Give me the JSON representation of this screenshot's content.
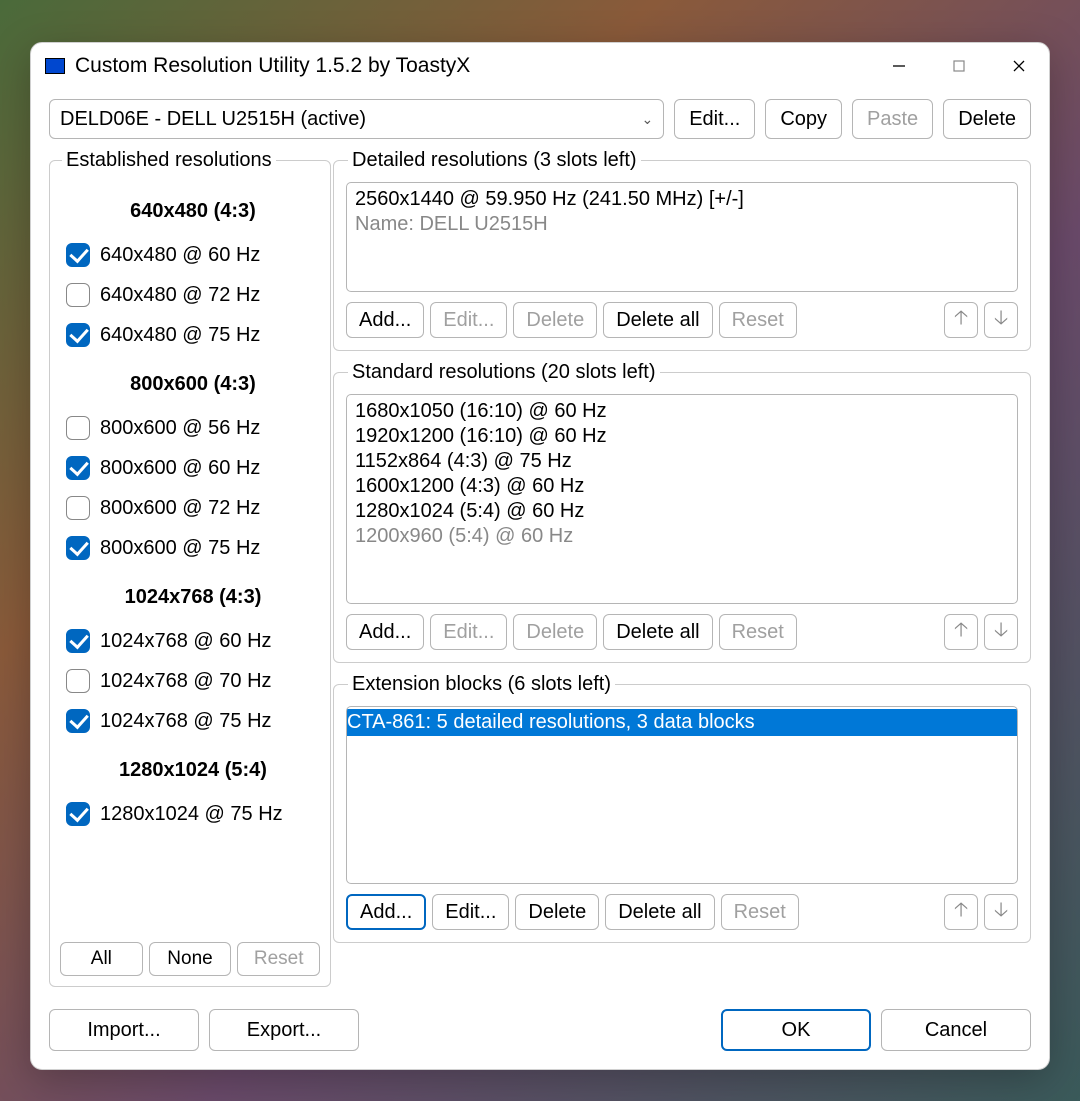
{
  "window": {
    "title": "Custom Resolution Utility 1.5.2 by ToastyX"
  },
  "topbar": {
    "display_selected": "DELD06E - DELL U2515H (active)",
    "edit_label": "Edit...",
    "copy_label": "Copy",
    "paste_label": "Paste",
    "delete_label": "Delete"
  },
  "established": {
    "legend": "Established resolutions",
    "groups": [
      {
        "header": "640x480 (4:3)",
        "items": [
          {
            "label": "640x480 @ 60 Hz",
            "checked": true
          },
          {
            "label": "640x480 @ 72 Hz",
            "checked": false
          },
          {
            "label": "640x480 @ 75 Hz",
            "checked": true
          }
        ]
      },
      {
        "header": "800x600 (4:3)",
        "items": [
          {
            "label": "800x600 @ 56 Hz",
            "checked": false
          },
          {
            "label": "800x600 @ 60 Hz",
            "checked": true
          },
          {
            "label": "800x600 @ 72 Hz",
            "checked": false
          },
          {
            "label": "800x600 @ 75 Hz",
            "checked": true
          }
        ]
      },
      {
        "header": "1024x768 (4:3)",
        "items": [
          {
            "label": "1024x768 @ 60 Hz",
            "checked": true
          },
          {
            "label": "1024x768 @ 70 Hz",
            "checked": false
          },
          {
            "label": "1024x768 @ 75 Hz",
            "checked": true
          }
        ]
      },
      {
        "header": "1280x1024 (5:4)",
        "items": [
          {
            "label": "1280x1024 @ 75 Hz",
            "checked": true
          }
        ]
      }
    ],
    "all_label": "All",
    "none_label": "None",
    "reset_label": "Reset"
  },
  "detailed": {
    "legend": "Detailed resolutions (3 slots left)",
    "items": [
      {
        "text": "2560x1440 @ 59.950 Hz (241.50 MHz) [+/-]",
        "gray": false
      },
      {
        "text": "Name: DELL U2515H",
        "gray": true
      }
    ],
    "add_label": "Add...",
    "edit_label": "Edit...",
    "delete_label": "Delete",
    "delete_all_label": "Delete all",
    "reset_label": "Reset"
  },
  "standard": {
    "legend": "Standard resolutions (20 slots left)",
    "items": [
      {
        "text": "1680x1050 (16:10) @ 60 Hz",
        "gray": false
      },
      {
        "text": "1920x1200 (16:10) @ 60 Hz",
        "gray": false
      },
      {
        "text": "1152x864 (4:3) @ 75 Hz",
        "gray": false
      },
      {
        "text": "1600x1200 (4:3) @ 60 Hz",
        "gray": false
      },
      {
        "text": "1280x1024 (5:4) @ 60 Hz",
        "gray": false
      },
      {
        "text": "1200x960 (5:4) @ 60 Hz",
        "gray": true
      }
    ],
    "add_label": "Add...",
    "edit_label": "Edit...",
    "delete_label": "Delete",
    "delete_all_label": "Delete all",
    "reset_label": "Reset"
  },
  "extension": {
    "legend": "Extension blocks (6 slots left)",
    "items": [
      {
        "text": "CTA-861: 5 detailed resolutions, 3 data blocks",
        "selected": true
      }
    ],
    "add_label": "Add...",
    "edit_label": "Edit...",
    "delete_label": "Delete",
    "delete_all_label": "Delete all",
    "reset_label": "Reset"
  },
  "footer": {
    "import_label": "Import...",
    "export_label": "Export...",
    "ok_label": "OK",
    "cancel_label": "Cancel"
  }
}
